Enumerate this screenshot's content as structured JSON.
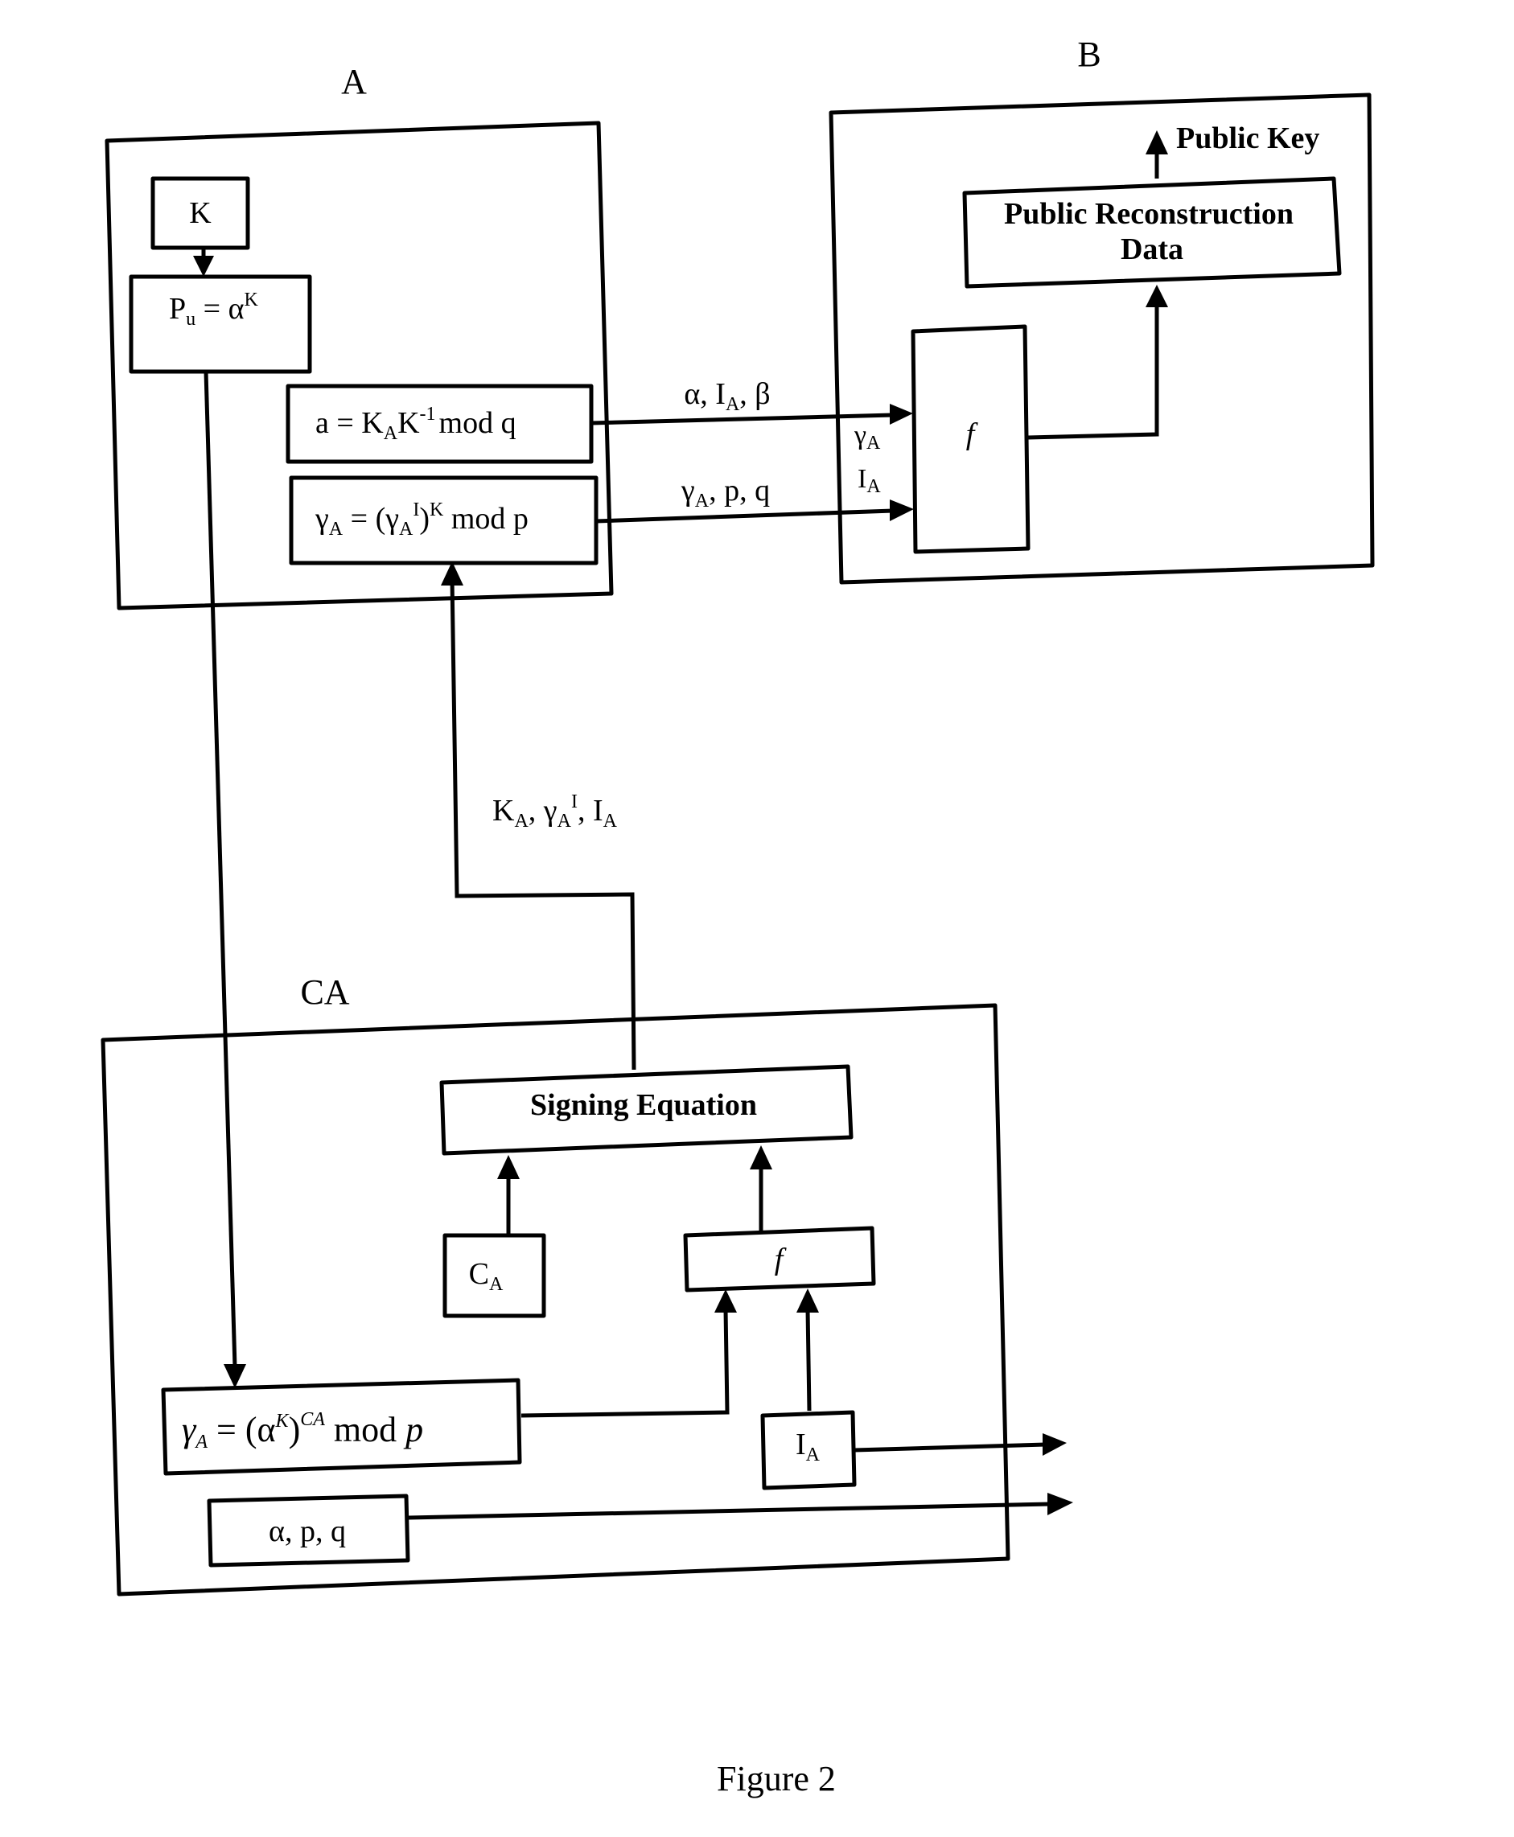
{
  "figure": {
    "caption": "Figure 2",
    "colors": {
      "ink": "#000000",
      "paper": "#ffffff"
    }
  },
  "entity_a": {
    "label": "A",
    "k_box": {
      "text": "K"
    },
    "pu_box": {
      "base": "P",
      "base_sub": "u",
      "eq": " = α",
      "exp": "K"
    },
    "a_box": {
      "lhs": "a = K",
      "sub": "A",
      "mid": "K",
      "exp": "-1",
      "rest": "mod q"
    },
    "gamma_box": {
      "lhs": "γ",
      "lhs_sub": "A",
      "eq": " = (γ",
      "inner_sub": "A",
      "inner_exp": "I",
      "close": ")",
      "exp": "K",
      "rest": " mod p"
    }
  },
  "entity_b": {
    "label": "B",
    "public_key": "Public Key",
    "prd_box": {
      "line1": "Public Reconstruction",
      "line2": "Data"
    },
    "f_box": {
      "text": "f"
    },
    "input_label_1": {
      "base": "γ",
      "sub": "A"
    },
    "input_label_2": {
      "base": "I",
      "sub": "A"
    }
  },
  "arrows_a_to_b": {
    "top": {
      "a": "α, I",
      "sub": "A",
      "b": ", β"
    },
    "bottom": {
      "a": "γ",
      "sub": "A",
      "b": ", p, q"
    }
  },
  "ca_to_a": {
    "k": "K",
    "k_sub": "A",
    "mid": ", γ",
    "g_sub": "A",
    "g_exp": "I",
    "end": ", I",
    "i_sub": "A"
  },
  "entity_ca": {
    "label": "CA",
    "signing_box": {
      "text": "Signing Equation"
    },
    "ca_box": {
      "base": "C",
      "sub": "A"
    },
    "f_box": {
      "text": "f"
    },
    "ia_box": {
      "base": "I",
      "sub": "A"
    },
    "gamma_eq_box": {
      "lhs": "γ",
      "lhs_sub": "A",
      "eq": " = (α",
      "exp": "K",
      "close": ")",
      "exp2": "CA",
      "rest": " mod ",
      "p": "p"
    },
    "params_box": {
      "text": "α, p, q"
    }
  }
}
